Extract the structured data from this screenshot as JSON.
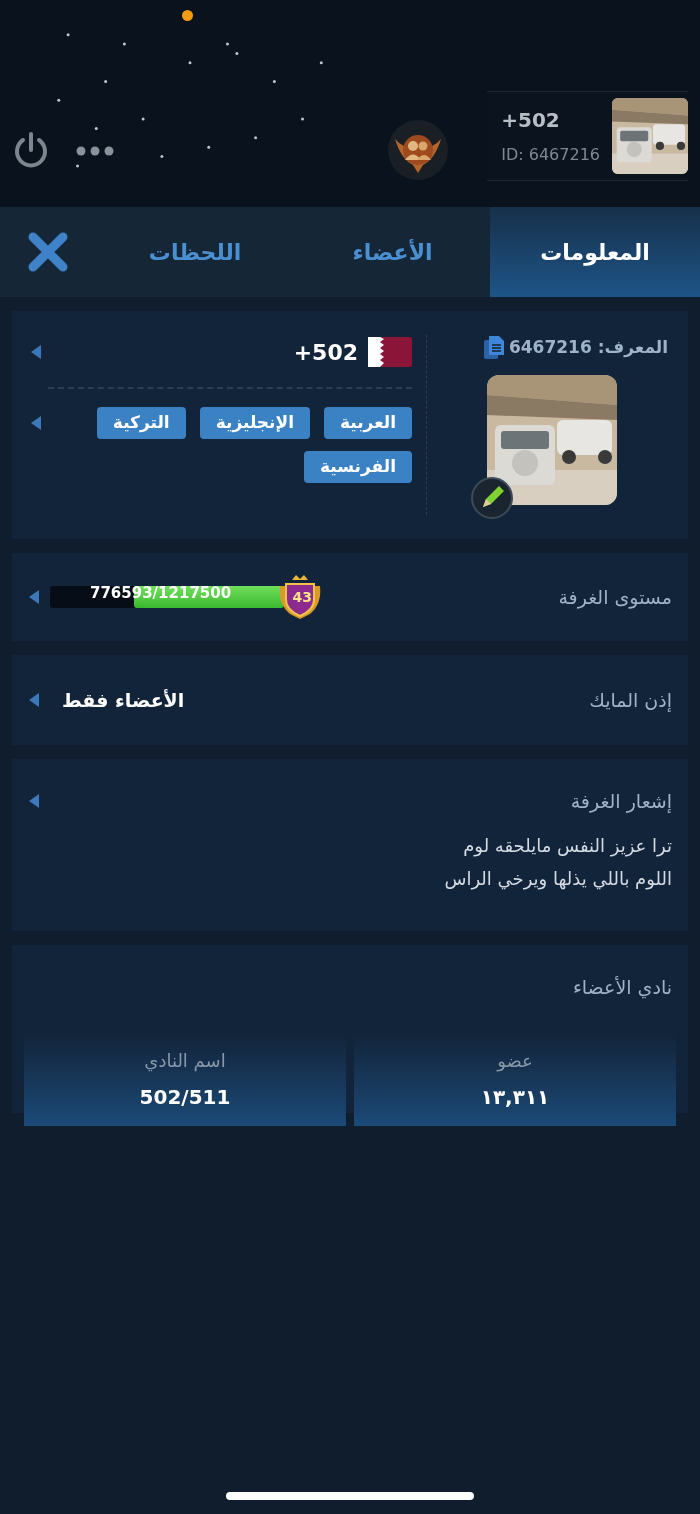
{
  "header": {
    "room_name": "+502",
    "room_id": "ID: 6467216"
  },
  "tabs": [
    {
      "label": "المعلومات",
      "selected": true
    },
    {
      "label": "الأعضاء",
      "selected": false
    },
    {
      "label": "اللحظات",
      "selected": false
    }
  ],
  "info": {
    "id_label": "المعرف:",
    "id_value": "6467216",
    "room_name": "+502",
    "languages": [
      "العربية",
      "الإنجليزية",
      "التركية",
      "الفرنسية"
    ]
  },
  "level_row": {
    "label": "مستوى الغرفة",
    "progress": "776593/1217500",
    "level": 0.64,
    "badge": "43"
  },
  "mic_row": {
    "label": "إذن المايك",
    "value": "الأعضاء فقط"
  },
  "notice": {
    "label": "إشعار الغرفة",
    "lines": [
      "ترا عزيز النفس مايلحقه لوم",
      "اللوم باللي يذلها ويرخي الراس"
    ]
  },
  "club": {
    "title": "نادي الأعضاء",
    "stats": [
      {
        "label": "عضو",
        "value": "١٣,٣١١"
      },
      {
        "label": "اسم النادي",
        "value": "502/511"
      }
    ]
  }
}
